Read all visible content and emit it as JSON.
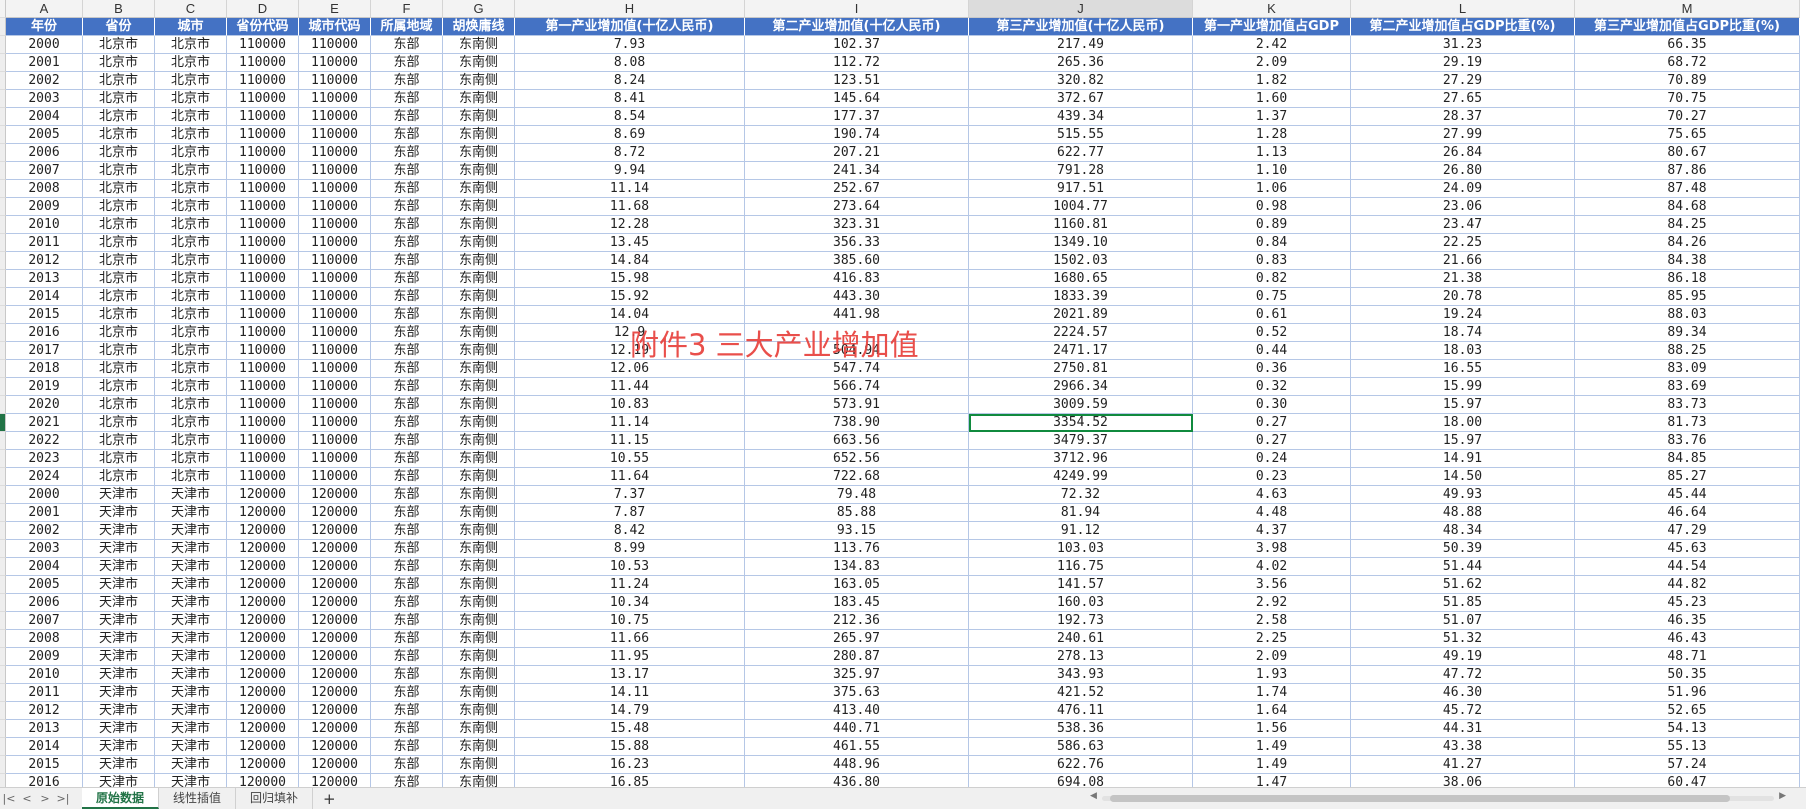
{
  "columns": [
    {
      "letter": "A",
      "width": 77
    },
    {
      "letter": "B",
      "width": 72
    },
    {
      "letter": "C",
      "width": 72
    },
    {
      "letter": "D",
      "width": 72
    },
    {
      "letter": "E",
      "width": 72
    },
    {
      "letter": "F",
      "width": 72
    },
    {
      "letter": "G",
      "width": 72
    },
    {
      "letter": "H",
      "width": 230
    },
    {
      "letter": "I",
      "width": 224
    },
    {
      "letter": "J",
      "width": 224
    },
    {
      "letter": "K",
      "width": 158
    },
    {
      "letter": "L",
      "width": 224
    },
    {
      "letter": "M",
      "width": 225
    }
  ],
  "active_column": "J",
  "headers": [
    "年份",
    "省份",
    "城市",
    "省份代码",
    "城市代码",
    "所属地域",
    "胡焕庸线",
    "第一产业增加值(十亿人民币)",
    "第二产业增加值(十亿人民币)",
    "第三产业增加值(十亿人民币)",
    "第一产业增加值占GDP",
    "第二产业增加值占GDP比重(%)",
    "第三产业增加值占GDP比重(%)"
  ],
  "rows": [
    [
      "2000",
      "北京市",
      "北京市",
      "110000",
      "110000",
      "东部",
      "东南侧",
      "7.93",
      "102.37",
      "217.49",
      "2.42",
      "31.23",
      "66.35"
    ],
    [
      "2001",
      "北京市",
      "北京市",
      "110000",
      "110000",
      "东部",
      "东南侧",
      "8.08",
      "112.72",
      "265.36",
      "2.09",
      "29.19",
      "68.72"
    ],
    [
      "2002",
      "北京市",
      "北京市",
      "110000",
      "110000",
      "东部",
      "东南侧",
      "8.24",
      "123.51",
      "320.82",
      "1.82",
      "27.29",
      "70.89"
    ],
    [
      "2003",
      "北京市",
      "北京市",
      "110000",
      "110000",
      "东部",
      "东南侧",
      "8.41",
      "145.64",
      "372.67",
      "1.60",
      "27.65",
      "70.75"
    ],
    [
      "2004",
      "北京市",
      "北京市",
      "110000",
      "110000",
      "东部",
      "东南侧",
      "8.54",
      "177.37",
      "439.34",
      "1.37",
      "28.37",
      "70.27"
    ],
    [
      "2005",
      "北京市",
      "北京市",
      "110000",
      "110000",
      "东部",
      "东南侧",
      "8.69",
      "190.74",
      "515.55",
      "1.28",
      "27.99",
      "75.65"
    ],
    [
      "2006",
      "北京市",
      "北京市",
      "110000",
      "110000",
      "东部",
      "东南侧",
      "8.72",
      "207.21",
      "622.77",
      "1.13",
      "26.84",
      "80.67"
    ],
    [
      "2007",
      "北京市",
      "北京市",
      "110000",
      "110000",
      "东部",
      "东南侧",
      "9.94",
      "241.34",
      "791.28",
      "1.10",
      "26.80",
      "87.86"
    ],
    [
      "2008",
      "北京市",
      "北京市",
      "110000",
      "110000",
      "东部",
      "东南侧",
      "11.14",
      "252.67",
      "917.51",
      "1.06",
      "24.09",
      "87.48"
    ],
    [
      "2009",
      "北京市",
      "北京市",
      "110000",
      "110000",
      "东部",
      "东南侧",
      "11.68",
      "273.64",
      "1004.77",
      "0.98",
      "23.06",
      "84.68"
    ],
    [
      "2010",
      "北京市",
      "北京市",
      "110000",
      "110000",
      "东部",
      "东南侧",
      "12.28",
      "323.31",
      "1160.81",
      "0.89",
      "23.47",
      "84.25"
    ],
    [
      "2011",
      "北京市",
      "北京市",
      "110000",
      "110000",
      "东部",
      "东南侧",
      "13.45",
      "356.33",
      "1349.10",
      "0.84",
      "22.25",
      "84.26"
    ],
    [
      "2012",
      "北京市",
      "北京市",
      "110000",
      "110000",
      "东部",
      "东南侧",
      "14.84",
      "385.60",
      "1502.03",
      "0.83",
      "21.66",
      "84.38"
    ],
    [
      "2013",
      "北京市",
      "北京市",
      "110000",
      "110000",
      "东部",
      "东南侧",
      "15.98",
      "416.83",
      "1680.65",
      "0.82",
      "21.38",
      "86.18"
    ],
    [
      "2014",
      "北京市",
      "北京市",
      "110000",
      "110000",
      "东部",
      "东南侧",
      "15.92",
      "443.30",
      "1833.39",
      "0.75",
      "20.78",
      "85.95"
    ],
    [
      "2015",
      "北京市",
      "北京市",
      "110000",
      "110000",
      "东部",
      "东南侧",
      "14.04",
      "441.98",
      "2021.89",
      "0.61",
      "19.24",
      "88.03"
    ],
    [
      "2016",
      "北京市",
      "北京市",
      "110000",
      "110000",
      "东部",
      "东南侧",
      "12.9",
      "",
      "2224.57",
      "0.52",
      "18.74",
      "89.34"
    ],
    [
      "2017",
      "北京市",
      "北京市",
      "110000",
      "110000",
      "东部",
      "东南侧",
      "12.19",
      "504.94",
      "2471.17",
      "0.44",
      "18.03",
      "88.25"
    ],
    [
      "2018",
      "北京市",
      "北京市",
      "110000",
      "110000",
      "东部",
      "东南侧",
      "12.06",
      "547.74",
      "2750.81",
      "0.36",
      "16.55",
      "83.09"
    ],
    [
      "2019",
      "北京市",
      "北京市",
      "110000",
      "110000",
      "东部",
      "东南侧",
      "11.44",
      "566.74",
      "2966.34",
      "0.32",
      "15.99",
      "83.69"
    ],
    [
      "2020",
      "北京市",
      "北京市",
      "110000",
      "110000",
      "东部",
      "东南侧",
      "10.83",
      "573.91",
      "3009.59",
      "0.30",
      "15.97",
      "83.73"
    ],
    [
      "2021",
      "北京市",
      "北京市",
      "110000",
      "110000",
      "东部",
      "东南侧",
      "11.14",
      "738.90",
      "3354.52",
      "0.27",
      "18.00",
      "81.73"
    ],
    [
      "2022",
      "北京市",
      "北京市",
      "110000",
      "110000",
      "东部",
      "东南侧",
      "11.15",
      "663.56",
      "3479.37",
      "0.27",
      "15.97",
      "83.76"
    ],
    [
      "2023",
      "北京市",
      "北京市",
      "110000",
      "110000",
      "东部",
      "东南侧",
      "10.55",
      "652.56",
      "3712.96",
      "0.24",
      "14.91",
      "84.85"
    ],
    [
      "2024",
      "北京市",
      "北京市",
      "110000",
      "110000",
      "东部",
      "东南侧",
      "11.64",
      "722.68",
      "4249.99",
      "0.23",
      "14.50",
      "85.27"
    ],
    [
      "2000",
      "天津市",
      "天津市",
      "120000",
      "120000",
      "东部",
      "东南侧",
      "7.37",
      "79.48",
      "72.32",
      "4.63",
      "49.93",
      "45.44"
    ],
    [
      "2001",
      "天津市",
      "天津市",
      "120000",
      "120000",
      "东部",
      "东南侧",
      "7.87",
      "85.88",
      "81.94",
      "4.48",
      "48.88",
      "46.64"
    ],
    [
      "2002",
      "天津市",
      "天津市",
      "120000",
      "120000",
      "东部",
      "东南侧",
      "8.42",
      "93.15",
      "91.12",
      "4.37",
      "48.34",
      "47.29"
    ],
    [
      "2003",
      "天津市",
      "天津市",
      "120000",
      "120000",
      "东部",
      "东南侧",
      "8.99",
      "113.76",
      "103.03",
      "3.98",
      "50.39",
      "45.63"
    ],
    [
      "2004",
      "天津市",
      "天津市",
      "120000",
      "120000",
      "东部",
      "东南侧",
      "10.53",
      "134.83",
      "116.75",
      "4.02",
      "51.44",
      "44.54"
    ],
    [
      "2005",
      "天津市",
      "天津市",
      "120000",
      "120000",
      "东部",
      "东南侧",
      "11.24",
      "163.05",
      "141.57",
      "3.56",
      "51.62",
      "44.82"
    ],
    [
      "2006",
      "天津市",
      "天津市",
      "120000",
      "120000",
      "东部",
      "东南侧",
      "10.34",
      "183.45",
      "160.03",
      "2.92",
      "51.85",
      "45.23"
    ],
    [
      "2007",
      "天津市",
      "天津市",
      "120000",
      "120000",
      "东部",
      "东南侧",
      "10.75",
      "212.36",
      "192.73",
      "2.58",
      "51.07",
      "46.35"
    ],
    [
      "2008",
      "天津市",
      "天津市",
      "120000",
      "120000",
      "东部",
      "东南侧",
      "11.66",
      "265.97",
      "240.61",
      "2.25",
      "51.32",
      "46.43"
    ],
    [
      "2009",
      "天津市",
      "天津市",
      "120000",
      "120000",
      "东部",
      "东南侧",
      "11.95",
      "280.87",
      "278.13",
      "2.09",
      "49.19",
      "48.71"
    ],
    [
      "2010",
      "天津市",
      "天津市",
      "120000",
      "120000",
      "东部",
      "东南侧",
      "13.17",
      "325.97",
      "343.93",
      "1.93",
      "47.72",
      "50.35"
    ],
    [
      "2011",
      "天津市",
      "天津市",
      "120000",
      "120000",
      "东部",
      "东南侧",
      "14.11",
      "375.63",
      "421.52",
      "1.74",
      "46.30",
      "51.96"
    ],
    [
      "2012",
      "天津市",
      "天津市",
      "120000",
      "120000",
      "东部",
      "东南侧",
      "14.79",
      "413.40",
      "476.11",
      "1.64",
      "45.72",
      "52.65"
    ],
    [
      "2013",
      "天津市",
      "天津市",
      "120000",
      "120000",
      "东部",
      "东南侧",
      "15.48",
      "440.71",
      "538.36",
      "1.56",
      "44.31",
      "54.13"
    ],
    [
      "2014",
      "天津市",
      "天津市",
      "120000",
      "120000",
      "东部",
      "东南侧",
      "15.88",
      "461.55",
      "586.63",
      "1.49",
      "43.38",
      "55.13"
    ],
    [
      "2015",
      "天津市",
      "天津市",
      "120000",
      "120000",
      "东部",
      "东南侧",
      "16.23",
      "448.96",
      "622.76",
      "1.49",
      "41.27",
      "57.24"
    ],
    [
      "2016",
      "天津市",
      "天津市",
      "120000",
      "120000",
      "东部",
      "东南侧",
      "16.85",
      "436.80",
      "694.08",
      "1.47",
      "38.06",
      "60.47"
    ]
  ],
  "selected_cell": {
    "row_index": 21,
    "column": "J"
  },
  "watermark": "附件3 三大产业增加值",
  "sheet_tabs": [
    {
      "label": "原始数据",
      "active": true
    },
    {
      "label": "线性插值",
      "active": false
    },
    {
      "label": "回归填补",
      "active": false
    }
  ],
  "add_tab_label": "+",
  "nav_buttons": [
    "|<",
    "<",
    ">",
    ">|"
  ],
  "colors": {
    "header_bg": "#4472c4",
    "grid_line": "#b5c7e6",
    "watermark": "#e8413c",
    "active_tab": "#217346",
    "selection": "#108a3e"
  }
}
